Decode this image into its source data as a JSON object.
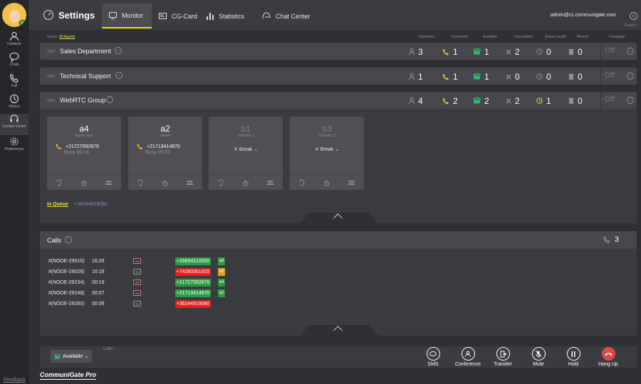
{
  "header": {
    "title": "Settings",
    "tabs": [
      {
        "label": "Monitor",
        "icon": "monitor-icon",
        "active": true
      },
      {
        "label": "CG-Card",
        "icon": "card-icon",
        "active": false
      },
      {
        "label": "Statistics",
        "icon": "bar-chart-icon",
        "active": false
      },
      {
        "label": "Chat Center",
        "icon": "chat-bubble-icon",
        "active": false
      }
    ],
    "user": "admin@cc.communigate.com",
    "lang": "English"
  },
  "rail": {
    "items": [
      {
        "label": "Contacts",
        "icon": "contacts-icon"
      },
      {
        "label": "Chats",
        "icon": "chats-icon"
      },
      {
        "label": "Call",
        "icon": "phone-icon"
      },
      {
        "label": "History",
        "icon": "clock-icon"
      },
      {
        "label": "Contact Center",
        "icon": "headset-icon"
      },
      {
        "label": "Preferences",
        "icon": "gear-icon"
      }
    ],
    "feedback": "Feedback"
  },
  "columns": {
    "queue": "Queue",
    "all_agents": "All Agents",
    "operators": "Operators",
    "connected": "Connected",
    "available": "Available",
    "unavailable": "Unavailable",
    "queue_length": "Queue length",
    "missed": "Missed",
    "campaign": "Campaign"
  },
  "queues": [
    {
      "num": "1002",
      "name": "Sales Department",
      "operators": "3",
      "connected": "1",
      "available": "1",
      "unavailable": "2",
      "queue_length": "0",
      "missed": "0",
      "campaign": "Off"
    },
    {
      "num": "1003",
      "name": "Technical Support",
      "operators": "1",
      "connected": "1",
      "available": "1",
      "unavailable": "0",
      "queue_length": "0",
      "missed": "0",
      "campaign": "Off"
    },
    {
      "num": "1006",
      "name": "WebRTC Group",
      "operators": "4",
      "connected": "2",
      "available": "2",
      "unavailable": "2",
      "queue_length": "1",
      "missed": "0",
      "campaign": "Off"
    }
  ],
  "agents": [
    {
      "id": "a4",
      "role": "Agent Four",
      "phone": "+21727592876",
      "status": "Busy 00:14"
    },
    {
      "id": "a2",
      "role": "James",
      "phone": "+21713414870",
      "status": "Busy 00:02"
    },
    {
      "id": "b1",
      "role": "Operator 1",
      "status": "Break"
    },
    {
      "id": "b3",
      "role": "Operator 3",
      "status": "Break"
    }
  ],
  "in_queue": {
    "label": "In Queue",
    "number": "+36244919080"
  },
  "calls": {
    "title": "Calls",
    "count": "3",
    "rows": [
      {
        "node": "#(NODE-29016)",
        "time": "16:26",
        "phone": "+28894110000",
        "agent": "a8",
        "phone_color": "#2e9a44",
        "agent_color": "#2e9a44",
        "icon_color": "red"
      },
      {
        "node": "#(NODE-29028)",
        "time": "16:18",
        "phone": "+74260351925",
        "agent": "a2",
        "phone_color": "#e02020",
        "agent_color": "#e0a020",
        "icon_color": "gray"
      },
      {
        "node": "#(NODE-29234)",
        "time": "00:19",
        "phone": "+21727592876",
        "agent": "a4",
        "phone_color": "#2e9a44",
        "agent_color": "#2e9a44",
        "icon_color": "red"
      },
      {
        "node": "#(NODE-29248)",
        "time": "00:07",
        "phone": "+21713414870",
        "agent": "a2",
        "phone_color": "#2e9a44",
        "agent_color": "#2e9a44",
        "icon_color": "red"
      },
      {
        "node": "#(NODE-29260)",
        "time": "00:06",
        "phone": "+36244919080",
        "agent": "",
        "phone_color": "#e02020",
        "agent_color": "",
        "icon_color": "gray"
      }
    ]
  },
  "bottom": {
    "status": "Available",
    "calls_label": "Calls",
    "actions": [
      "SMS",
      "Conference",
      "Transfer",
      "Mute",
      "Hold",
      "Hang Up"
    ]
  },
  "brand": "CommuniGate Pro"
}
